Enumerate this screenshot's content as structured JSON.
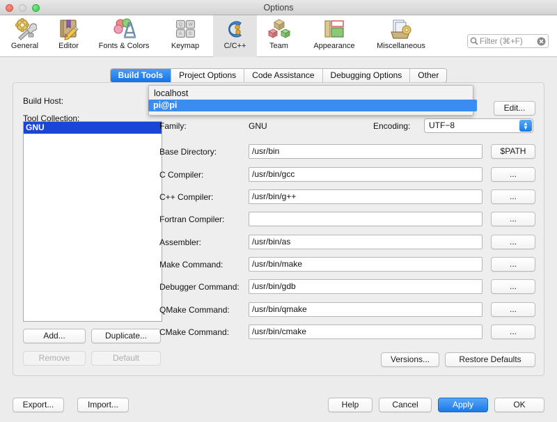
{
  "window": {
    "title": "Options",
    "traffic_lights": [
      "close-button",
      "minimize-button",
      "zoom-button"
    ]
  },
  "toolbar": {
    "items": [
      {
        "label": "General",
        "icon": "gear-wrench-icon",
        "selected": false
      },
      {
        "label": "Editor",
        "icon": "book-pencil-icon",
        "selected": false
      },
      {
        "label": "Fonts & Colors",
        "icon": "font-palette-icon",
        "selected": false
      },
      {
        "label": "Keymap",
        "icon": "keyboard-keys-icon",
        "selected": false
      },
      {
        "label": "C/C++",
        "icon": "c-language-icon",
        "selected": true
      },
      {
        "label": "Team",
        "icon": "team-cubes-icon",
        "selected": false
      },
      {
        "label": "Appearance",
        "icon": "appearance-layout-icon",
        "selected": false
      },
      {
        "label": "Miscellaneous",
        "icon": "misc-gear-files-icon",
        "selected": false
      }
    ]
  },
  "search": {
    "placeholder": "Filter (⌘+F)",
    "value": "",
    "icon": "search-icon",
    "clear_icon": "clear-circle-icon"
  },
  "tabs": [
    {
      "label": "Build Tools",
      "active": true
    },
    {
      "label": "Project Options",
      "active": false
    },
    {
      "label": "Code Assistance",
      "active": false
    },
    {
      "label": "Debugging Options",
      "active": false
    },
    {
      "label": "Other",
      "active": false
    }
  ],
  "build_host": {
    "label": "Build Host:",
    "selected_value": "pi@pi",
    "edit_label": "Edit...",
    "dropdown_open": true,
    "options": [
      {
        "label": "localhost",
        "selected": false
      },
      {
        "label": "pi@pi",
        "selected": true
      }
    ]
  },
  "tool_collection": {
    "label": "Tool Collection:",
    "items": [
      {
        "label": "GNU",
        "selected": true
      }
    ],
    "buttons": [
      {
        "label": "Add...",
        "enabled": true
      },
      {
        "label": "Duplicate...",
        "enabled": true
      },
      {
        "label": "Remove",
        "enabled": false
      },
      {
        "label": "Default",
        "enabled": false
      }
    ]
  },
  "details": {
    "family": {
      "label": "Family:",
      "value": "GNU"
    },
    "encoding": {
      "label": "Encoding:",
      "value": "UTF−8"
    },
    "fields": [
      {
        "label": "Base Directory:",
        "value": "/usr/bin",
        "button": "$PATH"
      },
      {
        "label": "C Compiler:",
        "value": "/usr/bin/gcc",
        "button": "..."
      },
      {
        "label": "C++ Compiler:",
        "value": "/usr/bin/g++",
        "button": "..."
      },
      {
        "label": "Fortran Compiler:",
        "value": "",
        "button": "..."
      },
      {
        "label": "Assembler:",
        "value": "/usr/bin/as",
        "button": "..."
      },
      {
        "label": "Make Command:",
        "value": "/usr/bin/make",
        "button": "..."
      },
      {
        "label": "Debugger Command:",
        "value": "/usr/bin/gdb",
        "button": "..."
      },
      {
        "label": "QMake Command:",
        "value": "/usr/bin/qmake",
        "button": "..."
      },
      {
        "label": "CMake Command:",
        "value": "/usr/bin/cmake",
        "button": "..."
      }
    ],
    "versions_label": "Versions...",
    "restore_label": "Restore Defaults"
  },
  "footer": {
    "export_label": "Export...",
    "import_label": "Import...",
    "help_label": "Help",
    "cancel_label": "Cancel",
    "apply_label": "Apply",
    "ok_label": "OK"
  },
  "colors": {
    "accent_blue": "#1a7ae8",
    "selection_blue": "#1a46d8",
    "popup_selection": "#3b8cf0",
    "window_bg": "#ececec",
    "panel_bg": "#eeeeee"
  }
}
